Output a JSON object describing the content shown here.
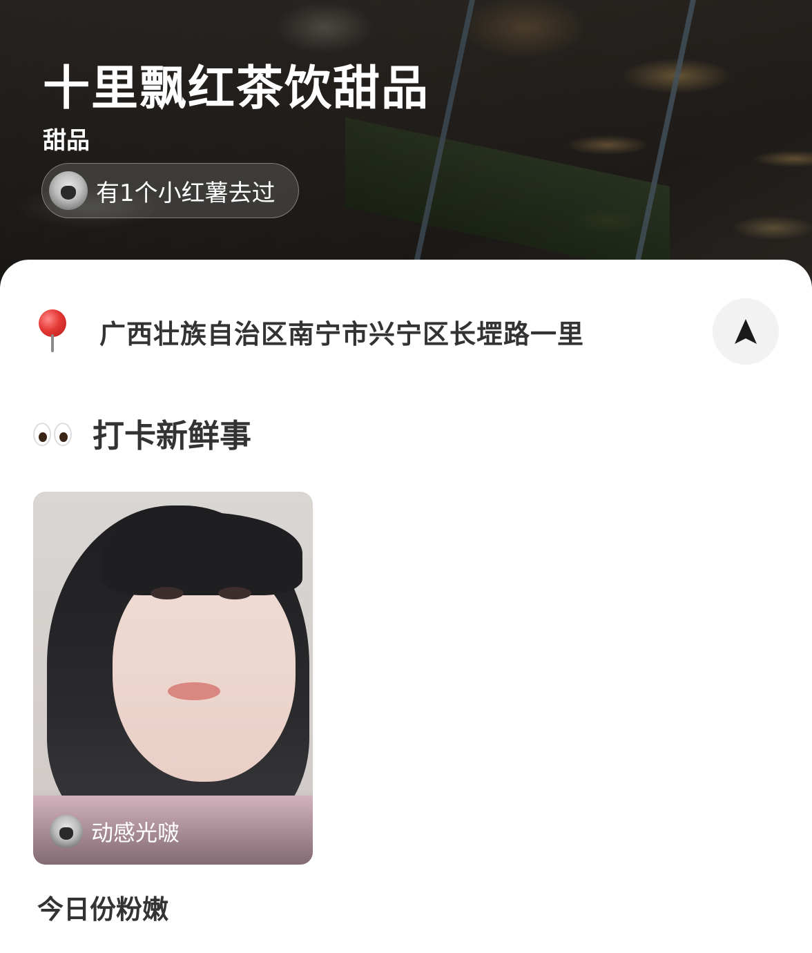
{
  "hero": {
    "title": "十里飘红茶饮甜品",
    "category": "甜品",
    "visited_text": "有1个小红薯去过"
  },
  "address": {
    "icon": "pin-icon",
    "text": "广西壮族自治区南宁市兴宁区长堽路一里",
    "nav_icon": "navigate-arrow-icon"
  },
  "section": {
    "icon": "eyes-icon",
    "title": "打卡新鲜事"
  },
  "posts": [
    {
      "author": "动感光啵",
      "caption": "今日份粉嫩"
    }
  ],
  "colors": {
    "text_primary": "#333333",
    "nav_button_bg": "#f2f2f2",
    "pin_red": "#e53935"
  }
}
